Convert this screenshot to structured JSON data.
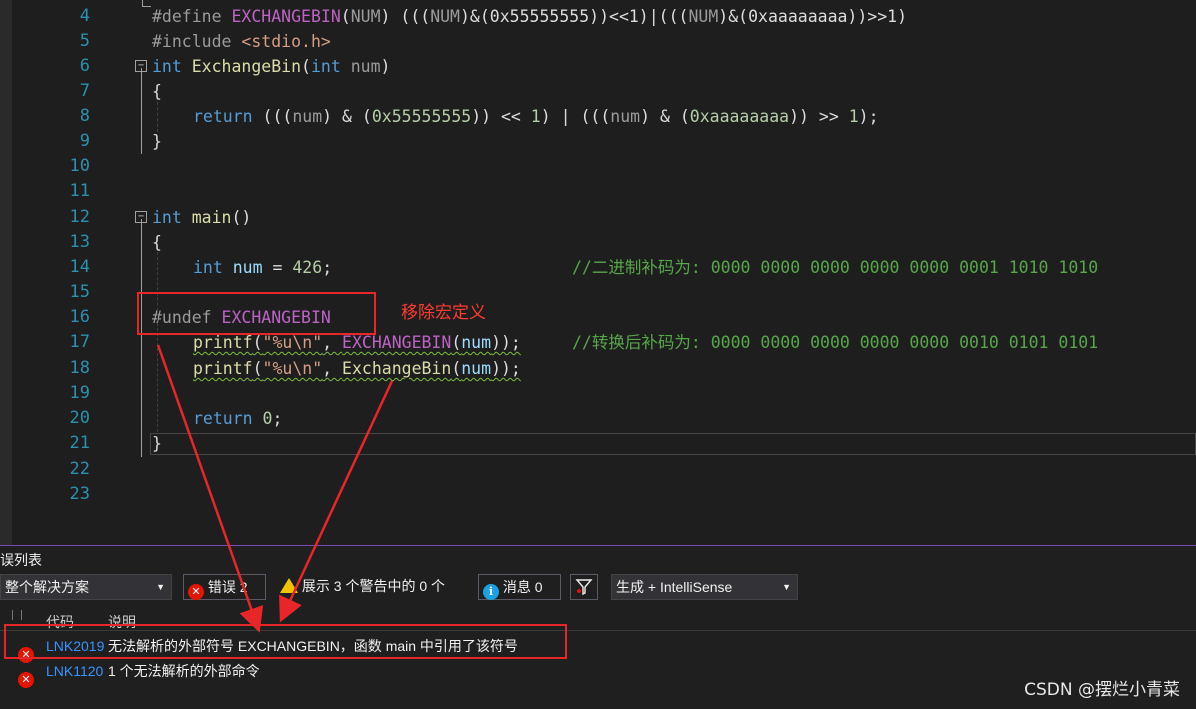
{
  "editor": {
    "lines": [
      {
        "n": "4",
        "text": "#define EXCHANGEBIN(NUM) (((NUM)&(0x55555555))<<1)|(((NUM)&(0xaaaaaaaa))>>1)"
      },
      {
        "n": "5",
        "text": "#include <stdio.h>"
      },
      {
        "n": "6",
        "text": "int ExchangeBin(int num)"
      },
      {
        "n": "7",
        "text": "{"
      },
      {
        "n": "8",
        "text": "return (((num) & (0x55555555)) << 1) | (((num) & (0xaaaaaaaa)) >> 1);"
      },
      {
        "n": "9",
        "text": "}"
      },
      {
        "n": "10",
        "text": ""
      },
      {
        "n": "11",
        "text": ""
      },
      {
        "n": "12",
        "text": "int main()"
      },
      {
        "n": "13",
        "text": "{"
      },
      {
        "n": "14",
        "text": "int num = 426;",
        "comment": "//二进制补码为: 0000 0000 0000 0000 0000 0001 1010 1010"
      },
      {
        "n": "15",
        "text": ""
      },
      {
        "n": "16",
        "text": "#undef EXCHANGEBIN"
      },
      {
        "n": "17",
        "text": "printf(\"%u\\n\", EXCHANGEBIN(num));",
        "comment": "//转换后补码为: 0000 0000 0000 0000 0000 0010 0101 0101"
      },
      {
        "n": "18",
        "text": "printf(\"%u\\n\", ExchangeBin(num));"
      },
      {
        "n": "19",
        "text": ""
      },
      {
        "n": "20",
        "text": "return 0;"
      },
      {
        "n": "21",
        "text": "}"
      },
      {
        "n": "22",
        "text": ""
      },
      {
        "n": "23",
        "text": ""
      }
    ],
    "fold_markers": {
      "l6": "−",
      "l12": "−"
    }
  },
  "annotation": {
    "label": "移除宏定义",
    "color": "#ff3b30"
  },
  "panel": {
    "title": "误列表",
    "scope_select": "整个解决方案",
    "errors_btn": {
      "icon": "✕",
      "label": "错误 2"
    },
    "warnings_btn": {
      "label": "展示 3 个警告中的 0 个"
    },
    "messages_btn": {
      "icon": "i",
      "label": "消息 0"
    },
    "filter_icon": "filter-icon",
    "build_select": "生成 + IntelliSense",
    "columns": {
      "code": "代码",
      "desc": "说明"
    },
    "rows": [
      {
        "code": "LNK2019",
        "desc": "无法解析的外部符号 EXCHANGEBIN，函数 main 中引用了该符号"
      },
      {
        "code": "LNK1120",
        "desc": "1 个无法解析的外部命令"
      }
    ]
  },
  "watermark": "CSDN @摆烂小青菜",
  "colors": {
    "accent": "#7a4bb8",
    "error": "#e51400",
    "link": "#3794ff",
    "annotation": "#e8262a"
  }
}
